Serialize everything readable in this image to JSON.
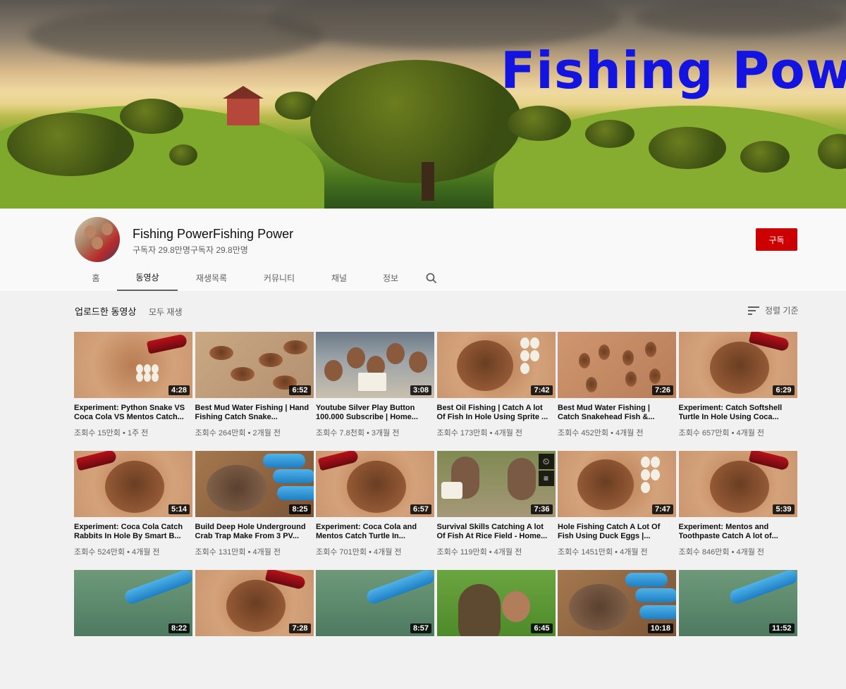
{
  "banner": {
    "title": "Fishing Pow"
  },
  "channel": {
    "name": "Fishing PowerFishing Power",
    "subscribers": "구독자 29.8만명구독자 29.8만명",
    "subscribe_label": "구독"
  },
  "tabs": [
    {
      "label": "홈",
      "active": false
    },
    {
      "label": "동영상",
      "active": true
    },
    {
      "label": "재생목록",
      "active": false
    },
    {
      "label": "커뮤니티",
      "active": false
    },
    {
      "label": "채널",
      "active": false
    },
    {
      "label": "정보",
      "active": false
    }
  ],
  "section": {
    "title": "업로드한 동영상",
    "play_all": "모두 재생",
    "sort_label": "정렬 기준"
  },
  "videos": [
    {
      "title": "Experiment: Python Snake VS Coca Cola VS Mentos Catch...",
      "meta": "조회수 15만회 • 1주 전",
      "duration": "4:28",
      "thumb": "soil-bottle-eggs"
    },
    {
      "title": "Best Mud Water Fishing | Hand Fishing Catch Snake...",
      "meta": "조회수 264만회 • 2개월 전",
      "duration": "6:52",
      "thumb": "mud-holes"
    },
    {
      "title": "Youtube Silver Play Button 100.000 Subscribe | Home...",
      "meta": "조회수 7.8천회 • 3개월 전",
      "duration": "3:08",
      "thumb": "people"
    },
    {
      "title": "Best Oil Fishing | Catch A lot Of Fish In Hole Using Sprite ...",
      "meta": "조회수 173만회 • 4개월 전",
      "duration": "7:42",
      "thumb": "hole-eggs"
    },
    {
      "title": "Best Mud Water Fishing | Catch Snakehead Fish &...",
      "meta": "조회수 452만회 • 4개월 전",
      "duration": "7:26",
      "thumb": "mud-fish"
    },
    {
      "title": "Experiment: Catch Softshell Turtle In Hole Using Coca...",
      "meta": "조회수 657만회 • 4개월 전",
      "duration": "6:29",
      "thumb": "hole-bottle"
    },
    {
      "title": "Experiment: Coca Cola Catch Rabbits In Hole By Smart B...",
      "meta": "조회수 524만회 • 4개월 전",
      "duration": "5:14",
      "thumb": "hole-bottle"
    },
    {
      "title": "Build Deep Hole Underground Crab Trap Make From 3 PV...",
      "meta": "조회수 131만회 • 4개월 전",
      "duration": "8:25",
      "thumb": "pipes"
    },
    {
      "title": "Experiment: Coca Cola and Mentos Catch Turtle In...",
      "meta": "조회수 701만회 • 4개월 전",
      "duration": "6:57",
      "thumb": "hole-bottle"
    },
    {
      "title": "Survival Skills Catching A lot Of Fish At Rice Field - Home...",
      "meta": "조회수 119만회 • 4개월 전",
      "duration": "7:36",
      "thumb": "people-field",
      "hover_icons": [
        "clock-icon",
        "queue-icon"
      ]
    },
    {
      "title": "Hole Fishing Catch A Lot Of Fish Using Duck Eggs |...",
      "meta": "조회수 1451만회 • 4개월 전",
      "duration": "7:47",
      "thumb": "hole-eggs"
    },
    {
      "title": "Experiment: Mentos and Toothpaste Catch A lot of...",
      "meta": "조회수 846만회 • 4개월 전",
      "duration": "5:39",
      "thumb": "hole-bottle"
    },
    {
      "title": "",
      "meta": "",
      "duration": "8:22",
      "thumb": "water-pipe"
    },
    {
      "title": "",
      "meta": "",
      "duration": "7:28",
      "thumb": "hole-bottle"
    },
    {
      "title": "",
      "meta": "",
      "duration": "8:57",
      "thumb": "water-pipe"
    },
    {
      "title": "",
      "meta": "",
      "duration": "6:45",
      "thumb": "grass-field"
    },
    {
      "title": "",
      "meta": "",
      "duration": "10:18",
      "thumb": "pipes"
    },
    {
      "title": "",
      "meta": "",
      "duration": "11:52",
      "thumb": "water-pipe"
    }
  ],
  "colors": {
    "subscribe": "#cc0000",
    "banner_title": "#1414e0"
  }
}
